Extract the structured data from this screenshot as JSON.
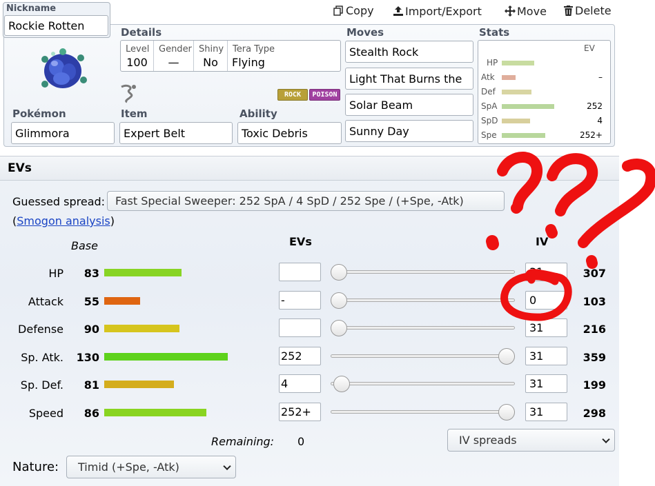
{
  "toolbar": {
    "copy": "Copy",
    "import_export": "Import/Export",
    "move": "Move",
    "delete": "Delete"
  },
  "nickname": {
    "label": "Nickname",
    "value": "Rockie Rotten"
  },
  "details": {
    "label": "Details",
    "level_label": "Level",
    "level": "100",
    "gender_label": "Gender",
    "gender": "—",
    "shiny_label": "Shiny",
    "shiny": "No",
    "tera_label": "Tera Type",
    "tera": "Flying"
  },
  "types": [
    "ROCK",
    "POISON"
  ],
  "pokemon": {
    "label": "Pokémon",
    "value": "Glimmora"
  },
  "item": {
    "label": "Item",
    "value": "Expert Belt"
  },
  "ability": {
    "label": "Ability",
    "value": "Toxic Debris"
  },
  "moves": {
    "label": "Moves",
    "list": [
      "Stealth Rock",
      "Light That Burns the",
      "Solar Beam",
      "Sunny Day"
    ]
  },
  "stats_summary": {
    "label": "Stats",
    "ev_header": "EV",
    "rows": [
      {
        "name": "HP",
        "ev": "",
        "color": "#c8dca0",
        "level": 0.26
      },
      {
        "name": "Atk",
        "ev": "–",
        "color": "#e0ae9c",
        "level": 0.11
      },
      {
        "name": "Def",
        "ev": "",
        "color": "#d8d5a2",
        "level": 0.24
      },
      {
        "name": "SpA",
        "ev": "252",
        "color": "#b8d79c",
        "level": 0.42
      },
      {
        "name": "SpD",
        "ev": "4",
        "color": "#d8cf9c",
        "level": 0.23
      },
      {
        "name": "Spe",
        "ev": "252+",
        "color": "#b8d79c",
        "level": 0.35
      }
    ]
  },
  "evs_section": {
    "title": "EVs",
    "guessed_label": "Guessed spread:",
    "guessed_value": "Fast Special Sweeper: 252 SpA / 4 SpD / 252 Spe / (+Spe, -Atk)",
    "smogon_prefix": "(",
    "smogon_link": "Smogon analysis",
    "smogon_suffix": ")",
    "base_header": "Base",
    "evs_header": "EVs",
    "iv_header": "IV",
    "remaining_label": "Remaining:",
    "remaining_value": "0",
    "iv_spreads": "IV spreads",
    "nature_label": "Nature:",
    "nature_value": "Timid (+Spe, -Atk)"
  },
  "stats": [
    {
      "name": "HP",
      "base": "83",
      "ev": "",
      "iv": "31",
      "total": "307",
      "bar_color": "#88d424",
      "bar_fraction": 0.43,
      "slider_fraction": 0.0
    },
    {
      "name": "Attack",
      "base": "55",
      "ev": "-",
      "iv": "0",
      "total": "103",
      "bar_color": "#df6511",
      "bar_fraction": 0.2,
      "slider_fraction": 0.0
    },
    {
      "name": "Defense",
      "base": "90",
      "ev": "",
      "iv": "31",
      "total": "216",
      "bar_color": "#d6c51e",
      "bar_fraction": 0.42,
      "slider_fraction": 0.0
    },
    {
      "name": "Sp. Atk.",
      "base": "130",
      "ev": "252",
      "iv": "31",
      "total": "359",
      "bar_color": "#5ed21c",
      "bar_fraction": 0.69,
      "slider_fraction": 1.0
    },
    {
      "name": "Sp. Def.",
      "base": "81",
      "ev": "4",
      "iv": "31",
      "total": "199",
      "bar_color": "#d4ad1d",
      "bar_fraction": 0.39,
      "slider_fraction": 0.015
    },
    {
      "name": "Speed",
      "base": "86",
      "ev": "252+",
      "iv": "31",
      "total": "298",
      "bar_color": "#89d421",
      "bar_fraction": 0.57,
      "slider_fraction": 1.0
    }
  ],
  "annotation": {
    "text": "???",
    "color": "#ee1111"
  }
}
